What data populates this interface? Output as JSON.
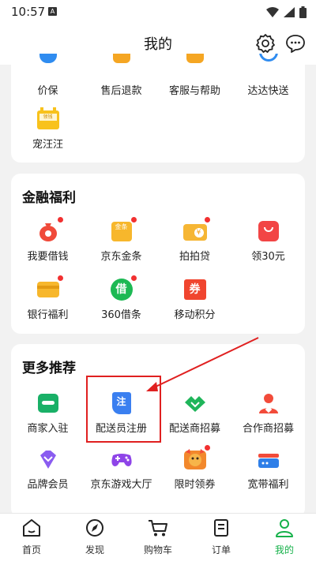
{
  "status": {
    "time": "10:57",
    "badge": "A"
  },
  "header": {
    "title": "我的"
  },
  "services": {
    "items": [
      "价保",
      "售后退款",
      "客服与帮助",
      "达达快送",
      "宠汪汪"
    ],
    "pet_icon_text": "领钱"
  },
  "finance": {
    "title": "金融福利",
    "items": [
      "我要借钱",
      "京东金条",
      "拍拍贷",
      "领30元",
      "银行福利",
      "360借条",
      "移动积分"
    ],
    "icon_texts": {
      "jintiao": "金条",
      "jie": "借",
      "quan": "券"
    }
  },
  "recommend": {
    "title": "更多推荐",
    "items": [
      "商家入驻",
      "配送员注册",
      "配送商招募",
      "合作商招募",
      "品牌会员",
      "京东游戏大厅",
      "限时领券",
      "宽带福利"
    ],
    "icon_texts": {
      "zhu": "注"
    }
  },
  "tabs": [
    "首页",
    "发现",
    "购物车",
    "订单",
    "我的"
  ],
  "colors": {
    "brand_green": "#16b14a",
    "accent_red": "#f23030",
    "annotation_red": "#e02020"
  }
}
